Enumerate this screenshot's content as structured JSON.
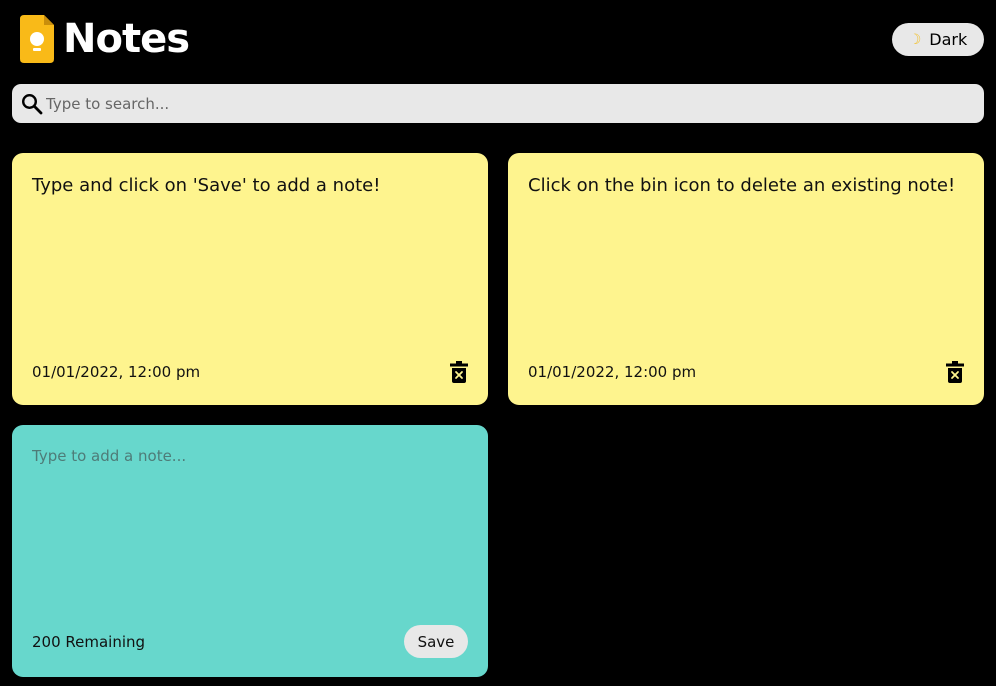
{
  "header": {
    "title": "Notes",
    "logo_icon": "lightbulb-note-icon",
    "theme_toggle": {
      "label": "Dark",
      "icon": "moon-icon"
    }
  },
  "search": {
    "placeholder": "Type to search...",
    "value": "",
    "icon": "search-icon"
  },
  "notes": [
    {
      "text": "Type and click on 'Save' to add a note!",
      "date": "01/01/2022, 12:00 pm",
      "delete_icon": "trash-icon"
    },
    {
      "text": "Click on the bin icon to delete an existing note!",
      "date": "01/01/2022, 12:00 pm",
      "delete_icon": "trash-icon"
    }
  ],
  "new_note": {
    "placeholder": "Type to add a note...",
    "value": "",
    "remaining": "200 Remaining",
    "save_label": "Save"
  },
  "colors": {
    "background": "#000000",
    "note": "#fef48e",
    "new_note": "#67d7cc",
    "logo": "#f9ba18",
    "control": "#e8e8e8"
  }
}
